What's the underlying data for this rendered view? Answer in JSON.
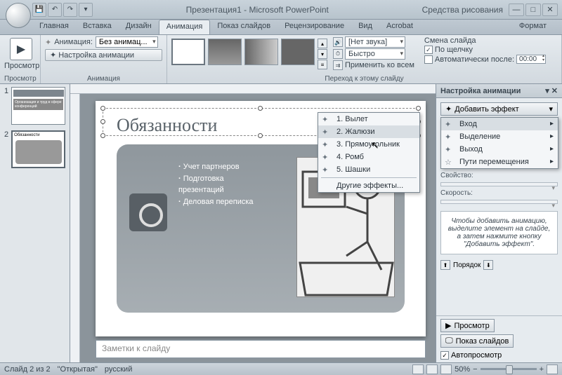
{
  "titlebar": {
    "title": "Презентация1 - Microsoft PowerPoint",
    "tools": "Средства рисования"
  },
  "qat": {
    "save": "💾",
    "undo": "↶",
    "redo": "↷"
  },
  "tabs": {
    "home": "Главная",
    "insert": "Вставка",
    "design": "Дизайн",
    "animation": "Анимация",
    "slideshow": "Показ слайдов",
    "review": "Рецензирование",
    "view": "Вид",
    "acrobat": "Acrobat",
    "format": "Формат"
  },
  "ribbon": {
    "preview": "Просмотр",
    "preview_group": "Просмотр",
    "anim_label": "Анимация:",
    "anim_value": "Без анимац...",
    "custom_anim": "Настройка анимации",
    "anim_group": "Анимация",
    "sound_label": "[Нет звука]",
    "speed_label": "Быстро",
    "apply_all": "Применить ко всем",
    "advance": "Смена слайда",
    "on_click": "По щелчку",
    "auto_after": "Автоматически после:",
    "auto_time": "00:00",
    "trans_group": "Переход к этому слайду"
  },
  "slide": {
    "title": "Обязанности",
    "bullets": [
      "Учет партнеров",
      "Подготовка презентаций",
      "Деловая переписка"
    ],
    "notes_placeholder": "Заметки к слайду"
  },
  "thumbs": {
    "s1_title": "Организация и труд в сфере конференций",
    "s2_title": "Обязанности"
  },
  "ctx_effects": {
    "i1": "1. Вылет",
    "i2": "2. Жалюзи",
    "i3": "3. Прямоугольник",
    "i4": "4. Ромб",
    "i5": "5. Шашки",
    "more": "Другие эффекты..."
  },
  "ctx_add": {
    "entry": "Вход",
    "emphasis": "Выделение",
    "exit": "Выход",
    "motion": "Пути перемещения"
  },
  "taskpane": {
    "title": "Настройка анимации",
    "add_effect": "Добавить эффект",
    "property": "Свойство:",
    "speed": "Скорость:",
    "hint": "Чтобы добавить анимацию, выделите элемент на слайде, а затем нажмите кнопку \"Добавить эффект\".",
    "reorder": "Порядок",
    "play": "Просмотр",
    "slideshow": "Показ слайдов",
    "autopreview": "Автопросмотр"
  },
  "status": {
    "slide": "Слайд 2 из 2",
    "theme": "\"Открытая\"",
    "lang": "русский",
    "zoom": "50%"
  }
}
